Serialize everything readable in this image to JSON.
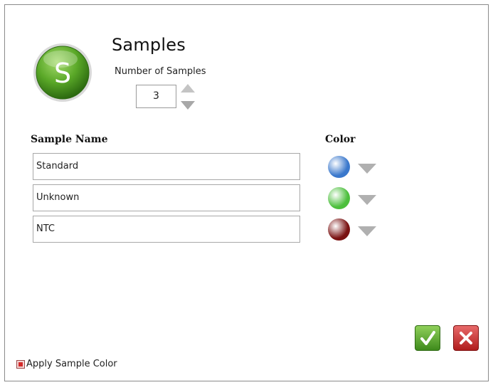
{
  "dialog": {
    "title": "Samples",
    "logo_letter": "S",
    "number_label": "Number of Samples",
    "number_value": "3"
  },
  "table": {
    "name_header": "Sample Name",
    "color_header": "Color",
    "rows": [
      {
        "name": "Standard",
        "color": "#3a78cc"
      },
      {
        "name": "Unknown",
        "color": "#4cbf3c"
      },
      {
        "name": "NTC",
        "color": "#7a1212"
      }
    ]
  },
  "footer": {
    "apply_label": "Apply Sample Color",
    "apply_checked": true
  },
  "colors": {
    "ok": "#4a9a24",
    "cancel": "#c42424",
    "logo": "#4a9a24"
  }
}
